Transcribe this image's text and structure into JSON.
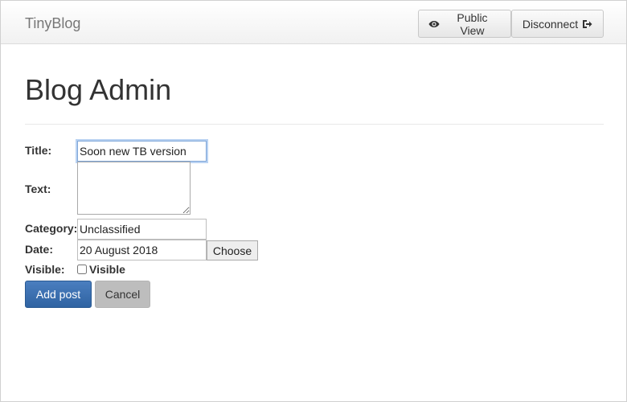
{
  "navbar": {
    "brand": "TinyBlog",
    "public_view_label": "Public View",
    "public_view_icon": "eye-icon",
    "disconnect_label": "Disconnect",
    "disconnect_icon": "sign-out-icon"
  },
  "page": {
    "title": "Blog Admin"
  },
  "form": {
    "title_label": "Title:",
    "title_value": "Soon new TB version",
    "text_label": "Text:",
    "text_value": "",
    "category_label": "Category:",
    "category_value": "Unclassified",
    "date_label": "Date:",
    "date_value": "20 August 2018",
    "choose_label": "Choose",
    "visible_label": "Visible:",
    "visible_checkbox_label": "Visible",
    "visible_checked": false,
    "add_post_label": "Add post",
    "cancel_label": "Cancel"
  },
  "colors": {
    "primary": "#3366a8",
    "cancel": "#bdbdbd"
  }
}
